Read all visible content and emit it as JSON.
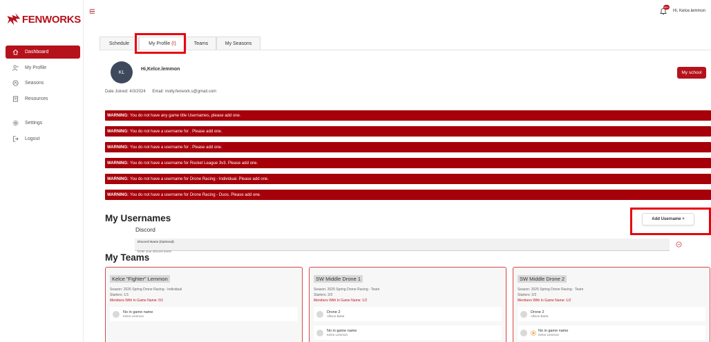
{
  "brand": {
    "name": "FENWORKS",
    "accent": "#b5121b"
  },
  "sidebar": {
    "items": [
      {
        "label": "Dashboard",
        "icon": "home-icon",
        "active": true
      },
      {
        "label": "My Profile",
        "icon": "user-icon"
      },
      {
        "label": "Seasons",
        "icon": "calendar-icon"
      },
      {
        "label": "Resources",
        "icon": "document-icon"
      },
      {
        "label": "Settings",
        "icon": "gear-icon"
      },
      {
        "label": "Logout",
        "icon": "logout-icon"
      }
    ]
  },
  "topbar": {
    "greeting": "Hi, Kelce.lemmon",
    "notification_count": "99+"
  },
  "tabs": [
    {
      "label": "Schedule"
    },
    {
      "label": "My Profile",
      "badge": "(!)",
      "active": true
    },
    {
      "label": "Teams"
    },
    {
      "label": "My Seasons"
    }
  ],
  "profile": {
    "initials": "KL",
    "greeting": "Hi,Kelce.lemmon",
    "school_button": "My school",
    "date_joined": "Date Joined: 4/3/2024",
    "email": "Email: molly.fenwork.s@gmail.com"
  },
  "warnings": [
    {
      "prefix": "WARNING:",
      "text": "You do not have any game title Usernames, please add one."
    },
    {
      "prefix": "WARNING:",
      "text": "You do not have a username for . Please add one."
    },
    {
      "prefix": "WARNING:",
      "text": "You do not have a username for . Please add one."
    },
    {
      "prefix": "WARNING:",
      "text": "You do not have a username for Rocket League 3v3. Please add one."
    },
    {
      "prefix": "WARNING:",
      "text": "You do not have a username for Drone Racing - Individual. Please add one."
    },
    {
      "prefix": "WARNING:",
      "text": "You do not have a username for Drone Racing - Duos. Please add one."
    }
  ],
  "usernames": {
    "title": "My Usernames",
    "add_button": "Add Username +",
    "platform": "Discord",
    "field_label": "Discord Name (Optional)",
    "field_placeholder": "Enter your discord name"
  },
  "teams": {
    "title": "My Teams",
    "cards": [
      {
        "name": "Kelce \"Fighter\" Lemmon",
        "season": "Season: 2026 Spring Drone Racing - Individual",
        "starters": "Starters: 1/1",
        "members_ign": "Members With In Game Name: 0/1",
        "members": [
          {
            "name": "No in game name",
            "sub": "Kelce Lemmon",
            "star": false
          }
        ]
      },
      {
        "name": "SW Middle Drone 1",
        "season": "Season: 2025 Spring Drone Racing - Team",
        "starters": "Starters: 2/2",
        "members_ign": "Members With In Game Name: 1/2",
        "members": [
          {
            "name": "Drone 2",
            "sub": "Allison Barta",
            "star": false
          },
          {
            "name": "No in game name",
            "sub": "Kelce Lemmon",
            "star": false
          }
        ]
      },
      {
        "name": "SW Middle Drone 2",
        "season": "Season: 2025 Spring Drone Racing - Team",
        "starters": "Starters: 2/2",
        "members_ign": "Members With In Game Name: 1/2",
        "members": [
          {
            "name": "Drone 2",
            "sub": "Allison Barta",
            "star": false
          },
          {
            "name": "No in game name",
            "sub": "Kelce Lemmon",
            "star": true
          }
        ]
      }
    ]
  }
}
